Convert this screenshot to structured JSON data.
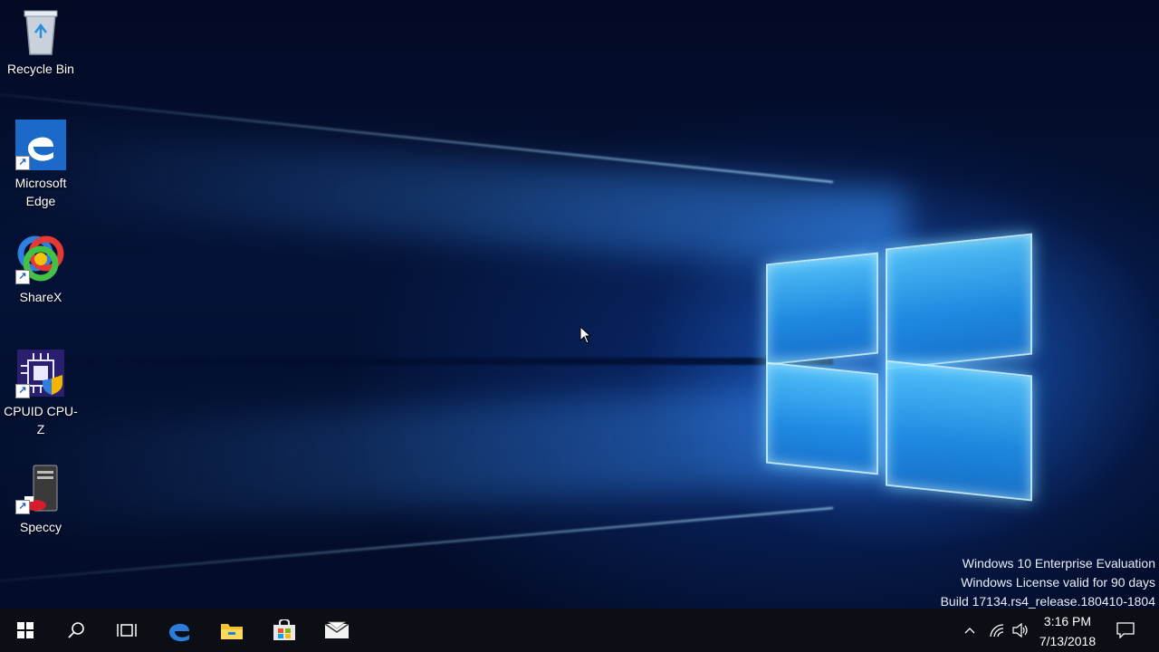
{
  "desktop": {
    "icons": [
      {
        "label": "Recycle Bin",
        "icon": "recycle-bin-icon"
      },
      {
        "label": "Microsoft\nEdge",
        "icon": "edge-icon"
      },
      {
        "label": "ShareX",
        "icon": "sharex-icon"
      },
      {
        "label": "CPUID CPU-Z",
        "icon": "cpuz-icon"
      },
      {
        "label": "Speccy",
        "icon": "speccy-icon"
      }
    ],
    "watermark": {
      "line1": "Windows 10 Enterprise Evaluation",
      "line2": "Windows License valid for 90 days",
      "line3": "Build 17134.rs4_release.180410-1804"
    }
  },
  "taskbar": {
    "buttons": [
      "start-icon",
      "search-icon",
      "task-view-icon",
      "edge-icon",
      "file-explorer-icon",
      "store-icon",
      "mail-icon"
    ],
    "clock": {
      "time": "3:16 PM",
      "date": "7/13/2018"
    },
    "tray": [
      "chevron-up-icon",
      "network-icon",
      "volume-icon",
      "action-center-icon"
    ]
  },
  "colors": {
    "accent": "#1f8fe6",
    "taskbar": "#0b0e14",
    "desktop": "#041236"
  }
}
